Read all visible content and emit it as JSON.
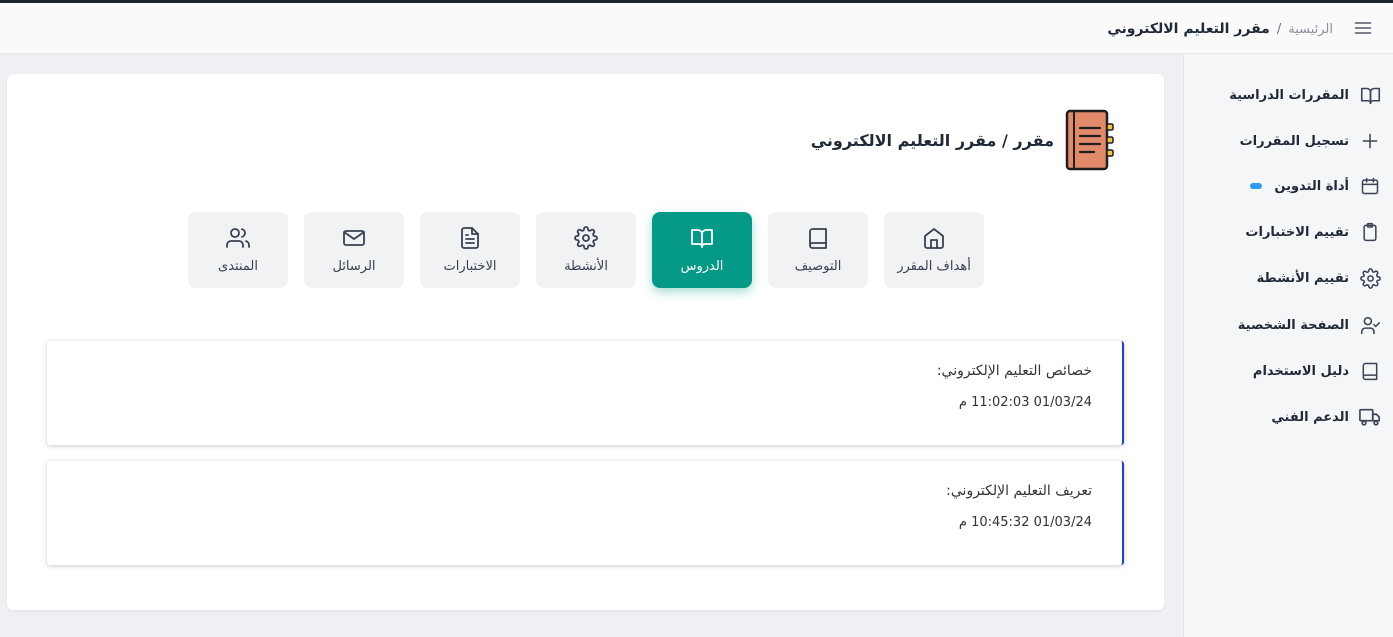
{
  "header": {
    "breadcrumb_home": "الرئيسية",
    "breadcrumb_separator": "/",
    "breadcrumb_current": "مقرر التعليم الالكتروني",
    "menu_icon": "hamburger-menu-icon"
  },
  "sidebar": {
    "items": [
      {
        "label": "المقررات الدراسية",
        "icon": "open-book-icon"
      },
      {
        "label": "تسجيل المقررات",
        "icon": "plus-icon"
      },
      {
        "label": "أداة التدوين",
        "icon": "calendar-icon",
        "badge_color": "#2f9bf2"
      },
      {
        "label": "تقييم الاختبارات",
        "icon": "clipboard-icon"
      },
      {
        "label": "تقييم الأنشطة",
        "icon": "gear-icon"
      },
      {
        "label": "الصفحة الشخصية",
        "icon": "user-check-icon"
      },
      {
        "label": "دليل الاستخدام",
        "icon": "book-icon"
      },
      {
        "label": "الدعم الفني",
        "icon": "truck-icon"
      }
    ]
  },
  "course": {
    "title": "مقرر / مقرر التعليم الالكتروني",
    "icon": "notebook-icon"
  },
  "tabs": [
    {
      "label": "أهداف المقرر",
      "icon": "home-icon",
      "active": false
    },
    {
      "label": "التوصيف",
      "icon": "book-icon",
      "active": false
    },
    {
      "label": "الدروس",
      "icon": "open-book-icon",
      "active": true
    },
    {
      "label": "الأنشطة",
      "icon": "gear-icon",
      "active": false
    },
    {
      "label": "الاختبارات",
      "icon": "document-icon",
      "active": false
    },
    {
      "label": "الرسائل",
      "icon": "mail-icon",
      "active": false
    },
    {
      "label": "المنتدى",
      "icon": "users-icon",
      "active": false
    }
  ],
  "lessons": [
    {
      "title": "خصائص التعليم الإلكتروني:",
      "timestamp": "01/03/24 11:02:03 م"
    },
    {
      "title": "تعريف التعليم الإلكتروني:",
      "timestamp": "01/03/24 10:45:32 م"
    }
  ],
  "colors": {
    "accent": "#049a87",
    "lesson_border": "#1f3fcf",
    "badge": "#2f9bf2",
    "notebook": "#e08a6a"
  }
}
